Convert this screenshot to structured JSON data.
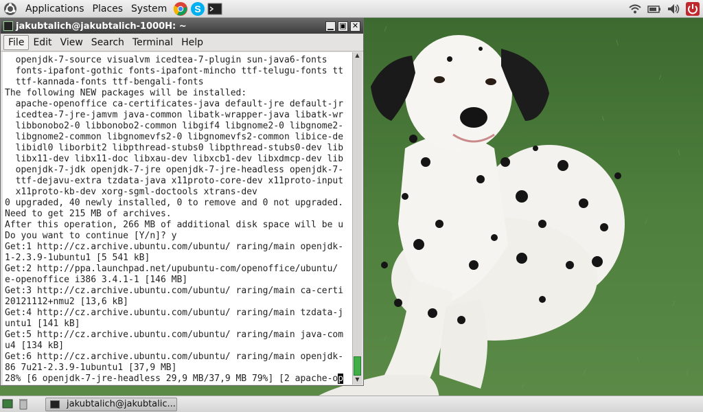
{
  "top_panel": {
    "menus": [
      "Applications",
      "Places",
      "System"
    ],
    "launchers": [
      "chrome-icon",
      "skype-icon",
      "terminal-icon"
    ],
    "tray": [
      "wifi-icon",
      "battery-icon",
      "volume-icon",
      "power-icon"
    ]
  },
  "window": {
    "title": "jakubtalich@jakubtalich-1000H: ~",
    "menu": [
      "File",
      "Edit",
      "View",
      "Search",
      "Terminal",
      "Help"
    ],
    "lines": [
      "  openjdk-7-source visualvm icedtea-7-plugin sun-java6-fonts",
      "  fonts-ipafont-gothic fonts-ipafont-mincho ttf-telugu-fonts tt",
      "  ttf-kannada-fonts ttf-bengali-fonts",
      "The following NEW packages will be installed:",
      "  apache-openoffice ca-certificates-java default-jre default-jr",
      "  icedtea-7-jre-jamvm java-common libatk-wrapper-java libatk-wr",
      "  libbonobo2-0 libbonobo2-common libgif4 libgnome2-0 libgnome2-",
      "  libgnome2-common libgnomevfs2-0 libgnomevfs2-common libice-de",
      "  libidl0 liborbit2 libpthread-stubs0 libpthread-stubs0-dev lib",
      "  libx11-dev libx11-doc libxau-dev libxcb1-dev libxdmcp-dev lib",
      "  openjdk-7-jdk openjdk-7-jre openjdk-7-jre-headless openjdk-7-",
      "  ttf-dejavu-extra tzdata-java x11proto-core-dev x11proto-input",
      "  x11proto-kb-dev xorg-sgml-doctools xtrans-dev",
      "0 upgraded, 40 newly installed, 0 to remove and 0 not upgraded.",
      "Need to get 215 MB of archives.",
      "After this operation, 266 MB of additional disk space will be u",
      "Do you want to continue [Y/n]? y",
      "Get:1 http://cz.archive.ubuntu.com/ubuntu/ raring/main openjdk-",
      "1-2.3.9-1ubuntu1 [5 541 kB]",
      "Get:2 http://ppa.launchpad.net/upubuntu-com/openoffice/ubuntu/",
      "e-openoffice i386 3.4.1-1 [146 MB]",
      "Get:3 http://cz.archive.ubuntu.com/ubuntu/ raring/main ca-certi",
      "20121112+nmu2 [13,6 kB]",
      "Get:4 http://cz.archive.ubuntu.com/ubuntu/ raring/main tzdata-j",
      "untu1 [141 kB]",
      "Get:5 http://cz.archive.ubuntu.com/ubuntu/ raring/main java-com",
      "u4 [134 kB]",
      "Get:6 http://cz.archive.ubuntu.com/ubuntu/ raring/main openjdk-",
      "86 7u21-2.3.9-1ubuntu1 [37,9 MB]"
    ],
    "progress_line": "28% [6 openjdk-7-jre-headless 29,9 MB/37,9 MB 79%] [2 apache-o",
    "cursor_char": "p"
  },
  "bottom_panel": {
    "task_label": "jakubtalich@jakubtalic..."
  },
  "colors": {
    "title_bar": "#4a4a4a",
    "scroll_thumb": "#3fae45",
    "grass": "#4f7a3e"
  }
}
